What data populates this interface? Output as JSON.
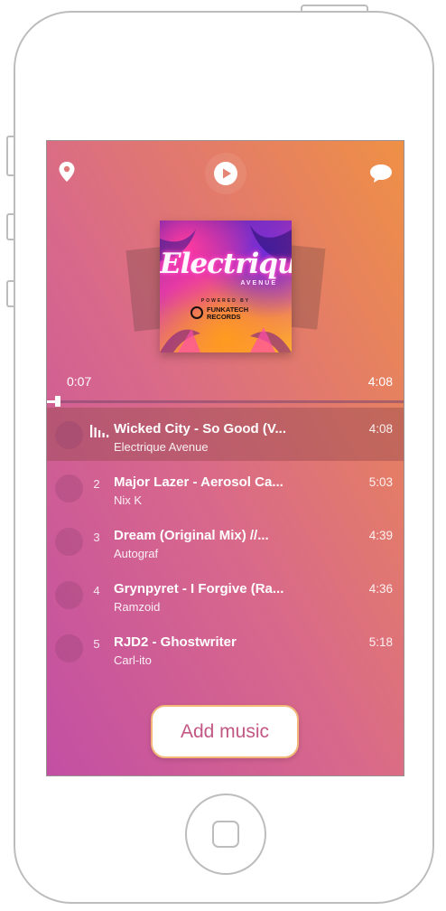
{
  "icons": {
    "location": "location-pin-icon",
    "play": "play-icon",
    "chat": "chat-bubble-icon",
    "now_playing": "equalizer-bars-icon"
  },
  "album": {
    "title": "Electrique",
    "subtitle": "AVENUE",
    "powered_by": "POWERED BY",
    "label_line1": "FUNKATECH",
    "label_line2": "RECORDS"
  },
  "player": {
    "elapsed": "0:07",
    "total": "4:08",
    "progress": 0.03
  },
  "tracks": [
    {
      "number": "",
      "title": "Wicked City - So Good (V...",
      "artist": "Electrique Avenue",
      "duration": "4:08",
      "playing": true
    },
    {
      "number": "2",
      "title": "Major Lazer - Aerosol Ca...",
      "artist": "Nix K",
      "duration": "5:03",
      "playing": false
    },
    {
      "number": "3",
      "title": "Dream (Original Mix) //...",
      "artist": "Autograf",
      "duration": "4:39",
      "playing": false
    },
    {
      "number": "4",
      "title": "Grynpyret - I Forgive (Ra...",
      "artist": "Ramzoid",
      "duration": "4:36",
      "playing": false
    },
    {
      "number": "5",
      "title": "RJD2 - Ghostwriter",
      "artist": "Carl-ito",
      "duration": "5:18",
      "playing": false
    }
  ],
  "add_button": {
    "label": "Add music"
  },
  "colors": {
    "gradient_start": "#c24fa3",
    "gradient_end": "#ef9045",
    "button_text": "#c35784",
    "button_border": "#f1b878"
  }
}
